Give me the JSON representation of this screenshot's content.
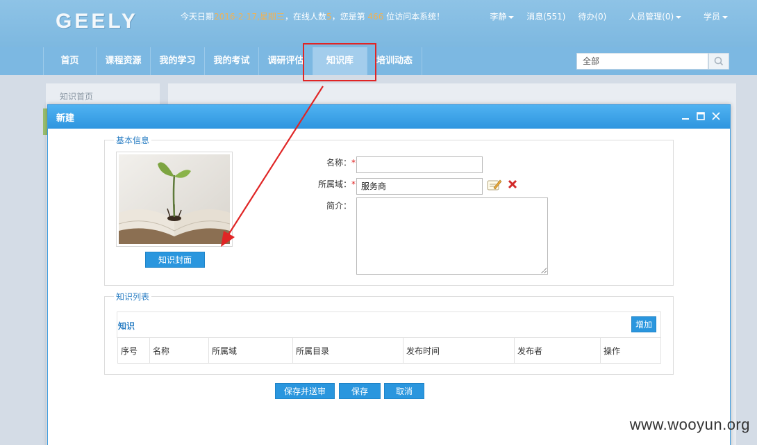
{
  "header": {
    "logo": "GEELY",
    "welcome": {
      "prefix": "今天日期",
      "date": "2016-2-17,星期三",
      "mid": "，在线人数",
      "online": "5",
      "mid2": "，您是第 ",
      "visitor_no": "466",
      "suffix": " 位访问本系统！"
    },
    "user": "李静",
    "messages": "消息(551)",
    "todo": "待办(0)",
    "people_mgmt": "人员管理(0)",
    "role": "学员"
  },
  "nav": {
    "items": [
      "首页",
      "课程资源",
      "我的学习",
      "我的考试",
      "调研评估",
      "知识库",
      "培训动态"
    ],
    "active": "知识库"
  },
  "search": {
    "value": "全部"
  },
  "background": {
    "sidebar_item": "知识首页"
  },
  "dialog": {
    "title": "新建",
    "basic_info": {
      "legend": "基本信息",
      "cover_button": "知识封面",
      "name_label": "名称：",
      "name_value": "",
      "domain_label": "所属域：",
      "domain_value": "服务商",
      "intro_label": "简介：",
      "required_mark": "*"
    },
    "knowledge_list": {
      "legend": "知识列表",
      "title": "知识",
      "add_button": "增加",
      "columns": [
        "序号",
        "名称",
        "所属域",
        "所属目录",
        "发布时间",
        "发布者",
        "操作"
      ]
    },
    "buttons": {
      "save_submit": "保存并送审",
      "save": "保存",
      "cancel": "取消"
    }
  },
  "watermark": "www.wooyun.org",
  "colors": {
    "accent": "#2a96de",
    "nav": "#7cb8e2",
    "highlight": "#f0b254",
    "annotation": "#e02525"
  }
}
